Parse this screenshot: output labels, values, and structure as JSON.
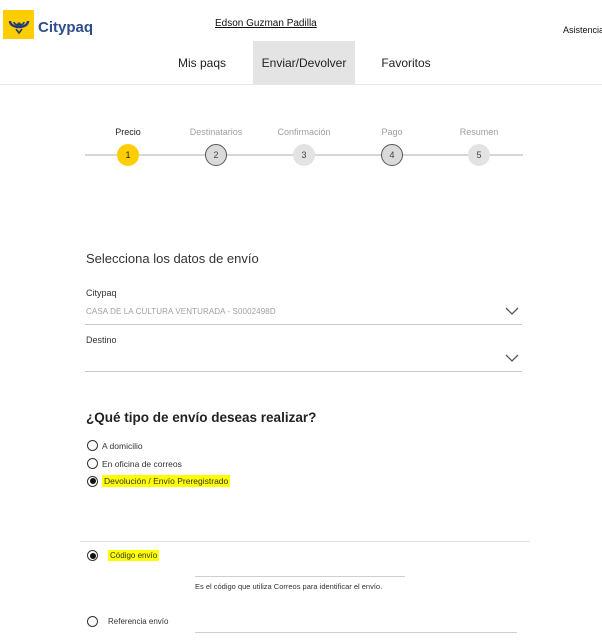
{
  "header": {
    "brand": "Citypaq",
    "user": "Edson Guzman Padilla",
    "help": "Asistencia"
  },
  "nav": {
    "tabs": [
      {
        "label": "Mis paqs"
      },
      {
        "label": "Enviar/Devolver"
      },
      {
        "label": "Favoritos"
      }
    ],
    "active": "Enviar/Devolver"
  },
  "stepper": {
    "current": 1,
    "steps": [
      {
        "label": "Precio",
        "number": "1"
      },
      {
        "label": "Destinatarios",
        "number": "2"
      },
      {
        "label": "Confirmación",
        "number": "3"
      },
      {
        "label": "Pago",
        "number": "4"
      },
      {
        "label": "Resumen",
        "number": "5"
      }
    ]
  },
  "form": {
    "title": "Selecciona los datos de envío",
    "citypaq_label": "Citypaq",
    "citypaq_value": "CASA DE LA CULTURA VENTURADA - S0002498D",
    "destino_label": "Destino",
    "destino_value": ""
  },
  "shipping": {
    "question": "¿Qué tipo de envío deseas realizar?",
    "options": [
      {
        "label": "A domicilio",
        "selected": false
      },
      {
        "label": "En oficina de correos",
        "selected": false
      },
      {
        "label": "Devolución / Envío Preregistrado",
        "selected": true
      }
    ]
  },
  "identification": {
    "code_label": "Código envío",
    "code_selected": true,
    "code_value": "",
    "code_help": "Es el código que utiliza Correos para identificar el envío.",
    "reference_label": "Referencia envío",
    "reference_selected": false,
    "reference_value": ""
  },
  "colors": {
    "brand_yellow": "#ffcd00",
    "brand_blue": "#2f4f8a",
    "highlight": "#ffff00",
    "active_tab": "#e4e4e4"
  }
}
